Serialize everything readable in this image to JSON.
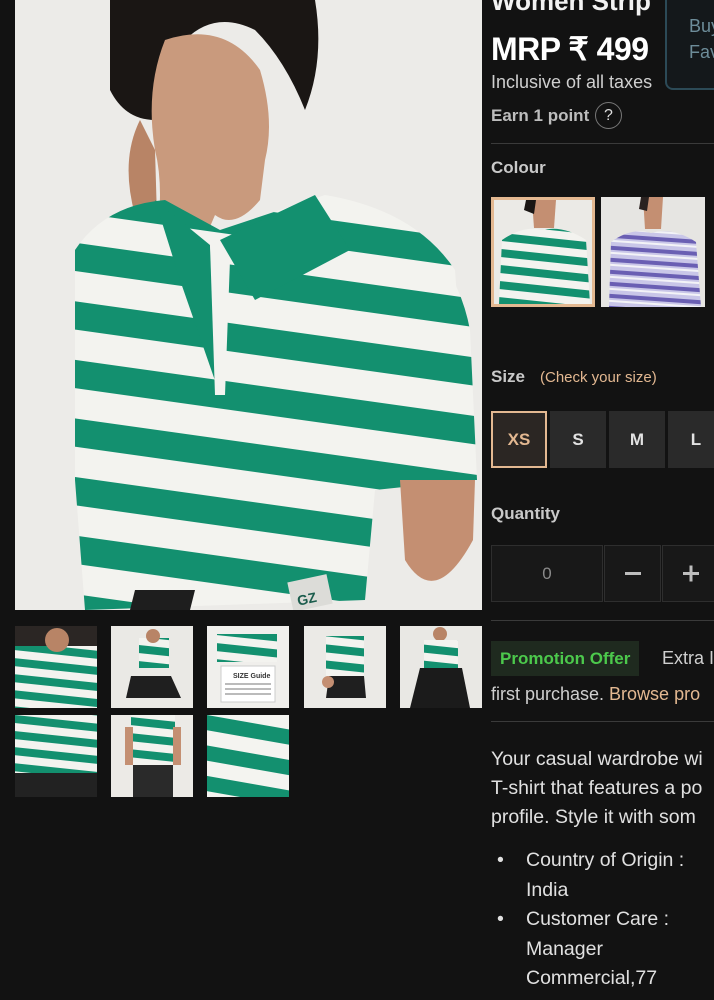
{
  "product": {
    "title": "Women Strip",
    "price": "MRP ₹ 499",
    "tax_note": "Inclusive of all taxes",
    "points": "Earn 1 point",
    "help_symbol": "?"
  },
  "buy_box": {
    "line1": "Buy",
    "line2": "Fav"
  },
  "gallery": {
    "main_alt": "green-white-striped-polo-tshirt",
    "thumbnails": [
      "thumb-1",
      "thumb-2",
      "thumb-3-size-guide",
      "thumb-4",
      "thumb-5",
      "thumb-6",
      "thumb-7",
      "thumb-8-fabric"
    ]
  },
  "colour": {
    "label": "Colour",
    "options": [
      "green-white-stripe",
      "lilac-stripe"
    ],
    "selected": "green-white-stripe"
  },
  "size": {
    "label": "Size",
    "check_link": "(Check your size)",
    "options": [
      "XS",
      "S",
      "M",
      "L"
    ],
    "selected": "XS"
  },
  "quantity": {
    "label": "Quantity",
    "value": "0",
    "decrement_icon": "minus-icon",
    "increment_icon": "plus-icon"
  },
  "promo": {
    "badge": "Promotion Offer",
    "text": "Extra I",
    "line2_prefix": "first purchase. ",
    "link": "Browse pro"
  },
  "description": {
    "lines": [
      "Your casual wardrobe wi",
      "T-shirt that features a po",
      "profile. Style it with som"
    ]
  },
  "details": {
    "country_line1": "Country of Origin :",
    "country_line2": "India",
    "care_line1": "Customer Care :",
    "care_line2": "Manager",
    "care_line3": "Commercial,77"
  },
  "colors": {
    "accent": "#e3b891",
    "promo_green": "#4cc94c",
    "stripe_green": "#13906f",
    "background": "#121212"
  }
}
